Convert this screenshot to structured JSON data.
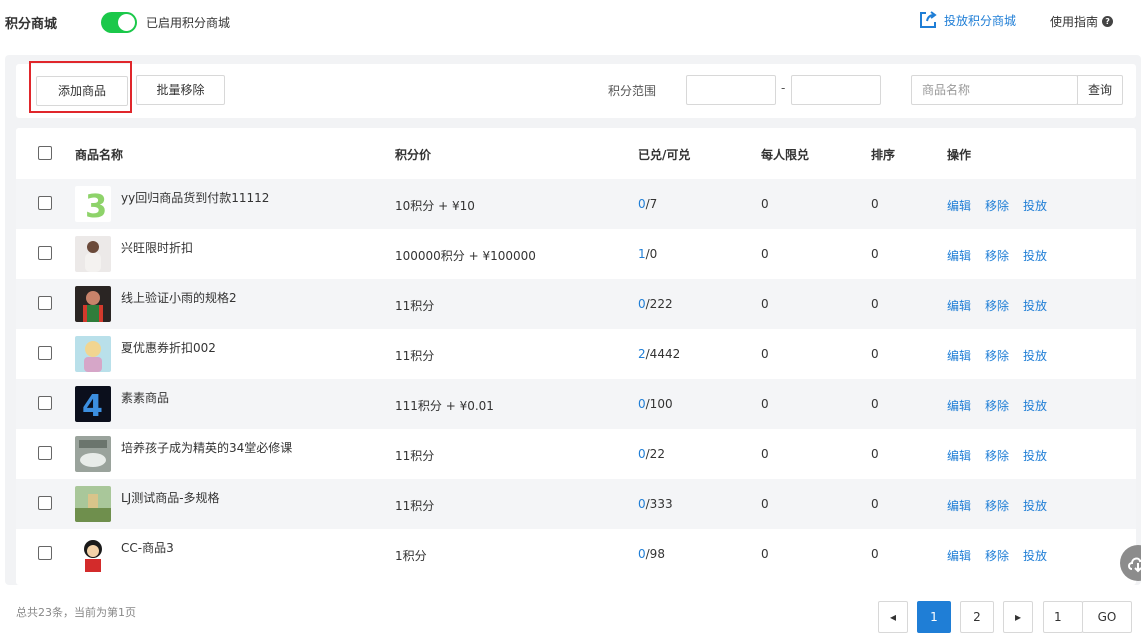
{
  "header": {
    "title": "积分商城",
    "toggle_label": "已启用积分商城",
    "launch_label": "投放积分商城",
    "guide_label": "使用指南"
  },
  "toolbar": {
    "add_label": "添加商品",
    "remove_label": "批量移除",
    "range_label": "积分范围",
    "range_sep": "-",
    "search_placeholder": "商品名称",
    "search_label": "查询"
  },
  "table": {
    "headers": [
      "商品名称",
      "积分价",
      "已兑/可兑",
      "每人限兑",
      "排序",
      "操作"
    ],
    "rows": [
      {
        "name": "yy回归商品货到付款11112",
        "price": "10积分 + ¥10",
        "redeemed": "0",
        "available": "/7",
        "limit": "0",
        "sort": "0"
      },
      {
        "name": "兴旺限时折扣",
        "price": "100000积分 + ¥100000",
        "redeemed": "1",
        "available": "/0",
        "limit": "0",
        "sort": "0"
      },
      {
        "name": "线上验证小雨的规格2",
        "price": "11积分",
        "redeemed": "0",
        "available": "/222",
        "limit": "0",
        "sort": "0"
      },
      {
        "name": "夏优惠券折扣002",
        "price": "11积分",
        "redeemed": "2",
        "available": "/4442",
        "limit": "0",
        "sort": "0"
      },
      {
        "name": "素素商品",
        "price": "111积分 + ¥0.01",
        "redeemed": "0",
        "available": "/100",
        "limit": "0",
        "sort": "0"
      },
      {
        "name": "培养孩子成为精英的34堂必修课",
        "price": "11积分",
        "redeemed": "0",
        "available": "/22",
        "limit": "0",
        "sort": "0"
      },
      {
        "name": "LJ测试商品-多规格",
        "price": "11积分",
        "redeemed": "0",
        "available": "/333",
        "limit": "0",
        "sort": "0"
      },
      {
        "name": "CC-商品3",
        "price": "1积分",
        "redeemed": "0",
        "available": "/98",
        "limit": "0",
        "sort": "0"
      }
    ],
    "ops": {
      "edit": "编辑",
      "remove": "移除",
      "launch": "投放"
    }
  },
  "footer": {
    "total": "总共23条，当前为第1页",
    "prev": "◂",
    "page1": "1",
    "page2": "2",
    "next": "▸",
    "jump_value": "1",
    "go_label": "GO"
  },
  "colors": {
    "accent": "#1f7ed6",
    "toggle_on": "#1bc84a",
    "highlight": "#e0262b"
  }
}
